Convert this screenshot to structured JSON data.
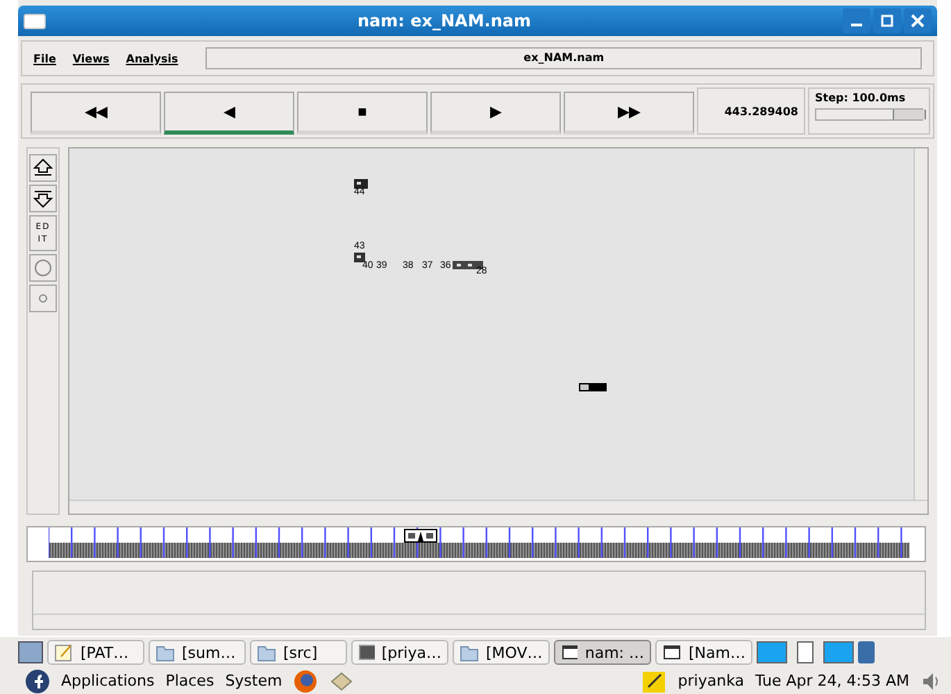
{
  "window": {
    "title": "nam: ex_NAM.nam"
  },
  "menu": [
    "File",
    "Views",
    "Analysis"
  ],
  "file_field": "ex_NAM.nam",
  "playback": [
    {
      "symbol": "◀◀",
      "selected": false
    },
    {
      "symbol": "◀",
      "selected": true
    },
    {
      "symbol": "■",
      "selected": false
    },
    {
      "symbol": "▶",
      "selected": false
    },
    {
      "symbol": "▶▶",
      "selected": false
    }
  ],
  "time": "443.289408",
  "step": {
    "label": "Step: 100.0ms",
    "level": 0.88
  },
  "tools": [
    {
      "kind": "up"
    },
    {
      "kind": "down"
    },
    {
      "kind": "edit",
      "label": "ED IT"
    },
    {
      "kind": "big-circle"
    },
    {
      "kind": "small-circle"
    }
  ],
  "nodes": [
    {
      "label": "44"
    },
    {
      "label": "43"
    },
    {
      "label": "40"
    },
    {
      "label": "39"
    },
    {
      "label": "38"
    },
    {
      "label": "37"
    },
    {
      "label": "36"
    },
    {
      "label": "28"
    }
  ],
  "timeline": {
    "level": 0.42
  },
  "taskbar": [
    {
      "kind": "note",
      "label": "[PAT…",
      "selected": false
    },
    {
      "kind": "folder",
      "label": "[sum…",
      "selected": false
    },
    {
      "kind": "folder",
      "label": "[src]",
      "selected": false
    },
    {
      "kind": "terminal",
      "label": "[priya…",
      "selected": false
    },
    {
      "kind": "folder",
      "label": "[MOV…",
      "selected": false
    },
    {
      "kind": "window",
      "label": "nam: …",
      "selected": true
    },
    {
      "kind": "window",
      "label": "[Nam…",
      "selected": false
    }
  ],
  "panel": {
    "menus": [
      "Applications",
      "Places",
      "System"
    ],
    "user": "priyanka",
    "clock": "Tue Apr 24,  4:53 AM"
  }
}
